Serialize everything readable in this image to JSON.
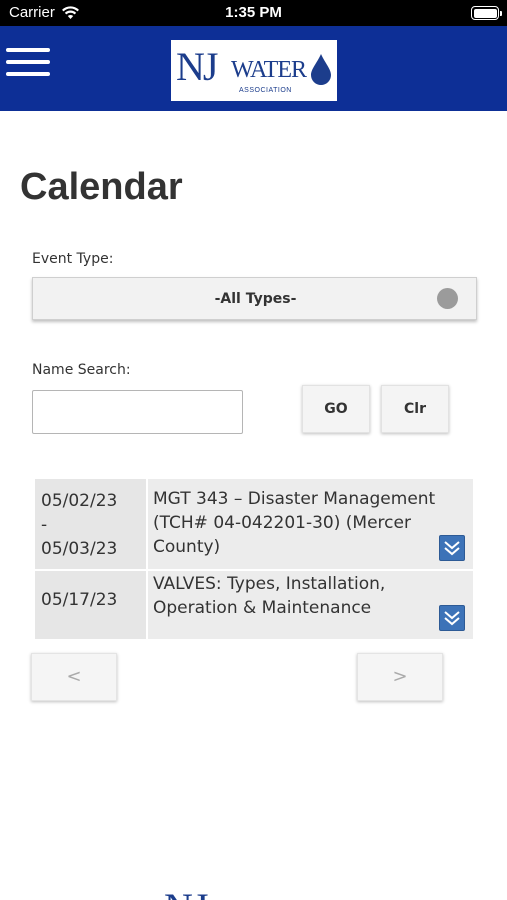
{
  "status_bar": {
    "carrier": "Carrier",
    "time": "1:35 PM"
  },
  "header": {
    "logo": {
      "nj": "NJ",
      "water": "WATER",
      "association": "ASSOCIATION"
    }
  },
  "page": {
    "title": "Calendar"
  },
  "filters": {
    "event_type_label": "Event Type:",
    "event_type_value": "-All Types-",
    "name_search_label": "Name Search:",
    "name_search_value": "",
    "go_label": "GO",
    "clear_label": "Clr"
  },
  "events": [
    {
      "date_start": "05/02/23",
      "separator": "-",
      "date_end": "05/03/23",
      "title": "MGT 343 – Disaster Management (TCH# 04-042201-30) (Mercer County)"
    },
    {
      "date": "05/17/23",
      "title": "VALVES: Types, Installation, Operation & Maintenance"
    }
  ],
  "pagination": {
    "prev_label": "<",
    "next_label": ">"
  },
  "colors": {
    "header_bg": "#0d2f96",
    "expand_icon": "#3d73b8",
    "row_bg": "#e6e6e6"
  }
}
